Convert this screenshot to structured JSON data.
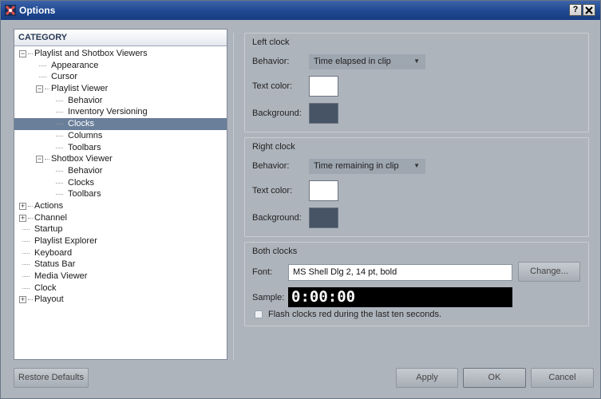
{
  "window": {
    "title": "Options",
    "help_label": "?",
    "close_label": "X"
  },
  "sidebar": {
    "header": "CATEGORY",
    "items": [
      {
        "label": "Playlist and Shotbox Viewers",
        "level": 0,
        "toggle": "−",
        "selected": false
      },
      {
        "label": "Appearance",
        "level": 1,
        "toggle": "",
        "selected": false
      },
      {
        "label": "Cursor",
        "level": 1,
        "toggle": "",
        "selected": false
      },
      {
        "label": "Playlist Viewer",
        "level": 1,
        "toggle": "−",
        "selected": false
      },
      {
        "label": "Behavior",
        "level": 2,
        "toggle": "",
        "selected": false
      },
      {
        "label": "Inventory Versioning",
        "level": 2,
        "toggle": "",
        "selected": false
      },
      {
        "label": "Clocks",
        "level": 2,
        "toggle": "",
        "selected": true
      },
      {
        "label": "Columns",
        "level": 2,
        "toggle": "",
        "selected": false
      },
      {
        "label": "Toolbars",
        "level": 2,
        "toggle": "",
        "selected": false
      },
      {
        "label": "Shotbox Viewer",
        "level": 1,
        "toggle": "−",
        "selected": false
      },
      {
        "label": "Behavior",
        "level": 2,
        "toggle": "",
        "selected": false
      },
      {
        "label": "Clocks",
        "level": 2,
        "toggle": "",
        "selected": false
      },
      {
        "label": "Toolbars",
        "level": 2,
        "toggle": "",
        "selected": false
      },
      {
        "label": "Actions",
        "level": 0,
        "toggle": "+",
        "selected": false
      },
      {
        "label": "Channel",
        "level": 0,
        "toggle": "+",
        "selected": false
      },
      {
        "label": "Startup",
        "level": 0,
        "toggle": "",
        "selected": false
      },
      {
        "label": "Playlist Explorer",
        "level": 0,
        "toggle": "",
        "selected": false
      },
      {
        "label": "Keyboard",
        "level": 0,
        "toggle": "",
        "selected": false
      },
      {
        "label": "Status Bar",
        "level": 0,
        "toggle": "",
        "selected": false
      },
      {
        "label": "Media Viewer",
        "level": 0,
        "toggle": "",
        "selected": false
      },
      {
        "label": "Clock",
        "level": 0,
        "toggle": "",
        "selected": false
      },
      {
        "label": "Playout",
        "level": 0,
        "toggle": "+",
        "selected": false
      }
    ]
  },
  "left_clock": {
    "title": "Left clock",
    "behavior_label": "Behavior:",
    "behavior_value": "Time elapsed in clip",
    "text_color_label": "Text color:",
    "text_color": "#ffffff",
    "background_label": "Background:",
    "background_color": "#465466"
  },
  "right_clock": {
    "title": "Right clock",
    "behavior_label": "Behavior:",
    "behavior_value": "Time remaining in clip",
    "text_color_label": "Text color:",
    "text_color": "#ffffff",
    "background_label": "Background:",
    "background_color": "#465466"
  },
  "both_clocks": {
    "title": "Both clocks",
    "font_label": "Font:",
    "font_value": "MS Shell Dlg 2, 14 pt, bold",
    "change_label": "Change...",
    "sample_label": "Sample:",
    "sample_value": "0:00:00",
    "flash_label": "Flash clocks red during the last ten seconds.",
    "flash_checked": false
  },
  "footer": {
    "restore_label": "Restore Defaults",
    "apply_label": "Apply",
    "ok_label": "OK",
    "cancel_label": "Cancel"
  },
  "icons": {
    "app": "options-app-icon",
    "dropdown": "chevron-down-icon",
    "expand": "tree-expand-icon",
    "collapse": "tree-collapse-icon"
  }
}
